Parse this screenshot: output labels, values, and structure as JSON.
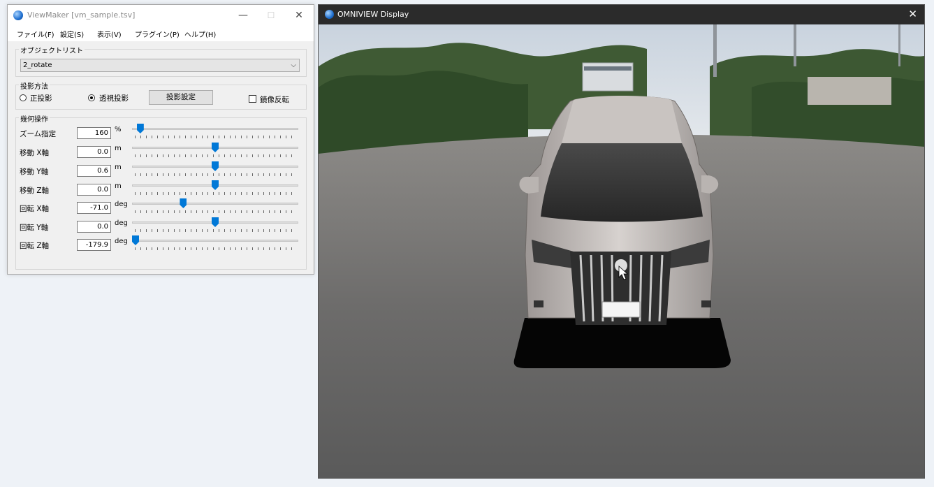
{
  "viewmaker": {
    "title": "ViewMaker [vm_sample.tsv]",
    "controls": {
      "minimize": "—",
      "maximize": "☐",
      "close": "✕"
    },
    "menu": [
      "ファイル(F)",
      "設定(S)",
      "表示(V)",
      "プラグイン(P)",
      "ヘルプ(H)"
    ],
    "object_list": {
      "label": "オブジェクトリスト",
      "selected": "2_rotate"
    },
    "projection": {
      "label": "投影方法",
      "ortho_label": "正投影",
      "persp_label": "透視投影",
      "selected": "persp",
      "settings_button": "投影設定",
      "mirror_label": "鏡像反転",
      "mirror_checked": false
    },
    "geometry": {
      "label": "幾何操作",
      "rows": [
        {
          "label": "ズーム指定",
          "value": "160",
          "unit": "%",
          "fraction": 0.03
        },
        {
          "label": "移動 X軸",
          "value": "0.0",
          "unit": "m",
          "fraction": 0.5
        },
        {
          "label": "移動 Y軸",
          "value": "0.6",
          "unit": "m",
          "fraction": 0.5
        },
        {
          "label": "移動 Z軸",
          "value": "0.0",
          "unit": "m",
          "fraction": 0.5
        },
        {
          "label": "回転 X軸",
          "value": "-71.0",
          "unit": "deg",
          "fraction": 0.3
        },
        {
          "label": "回転 Y軸",
          "value": "0.0",
          "unit": "deg",
          "fraction": 0.5
        },
        {
          "label": "回転 Z軸",
          "value": "-179.9",
          "unit": "deg",
          "fraction": 0.0
        }
      ]
    }
  },
  "display": {
    "title": "OMNIVIEW Display",
    "close": "✕",
    "accent": "#0078d7"
  }
}
